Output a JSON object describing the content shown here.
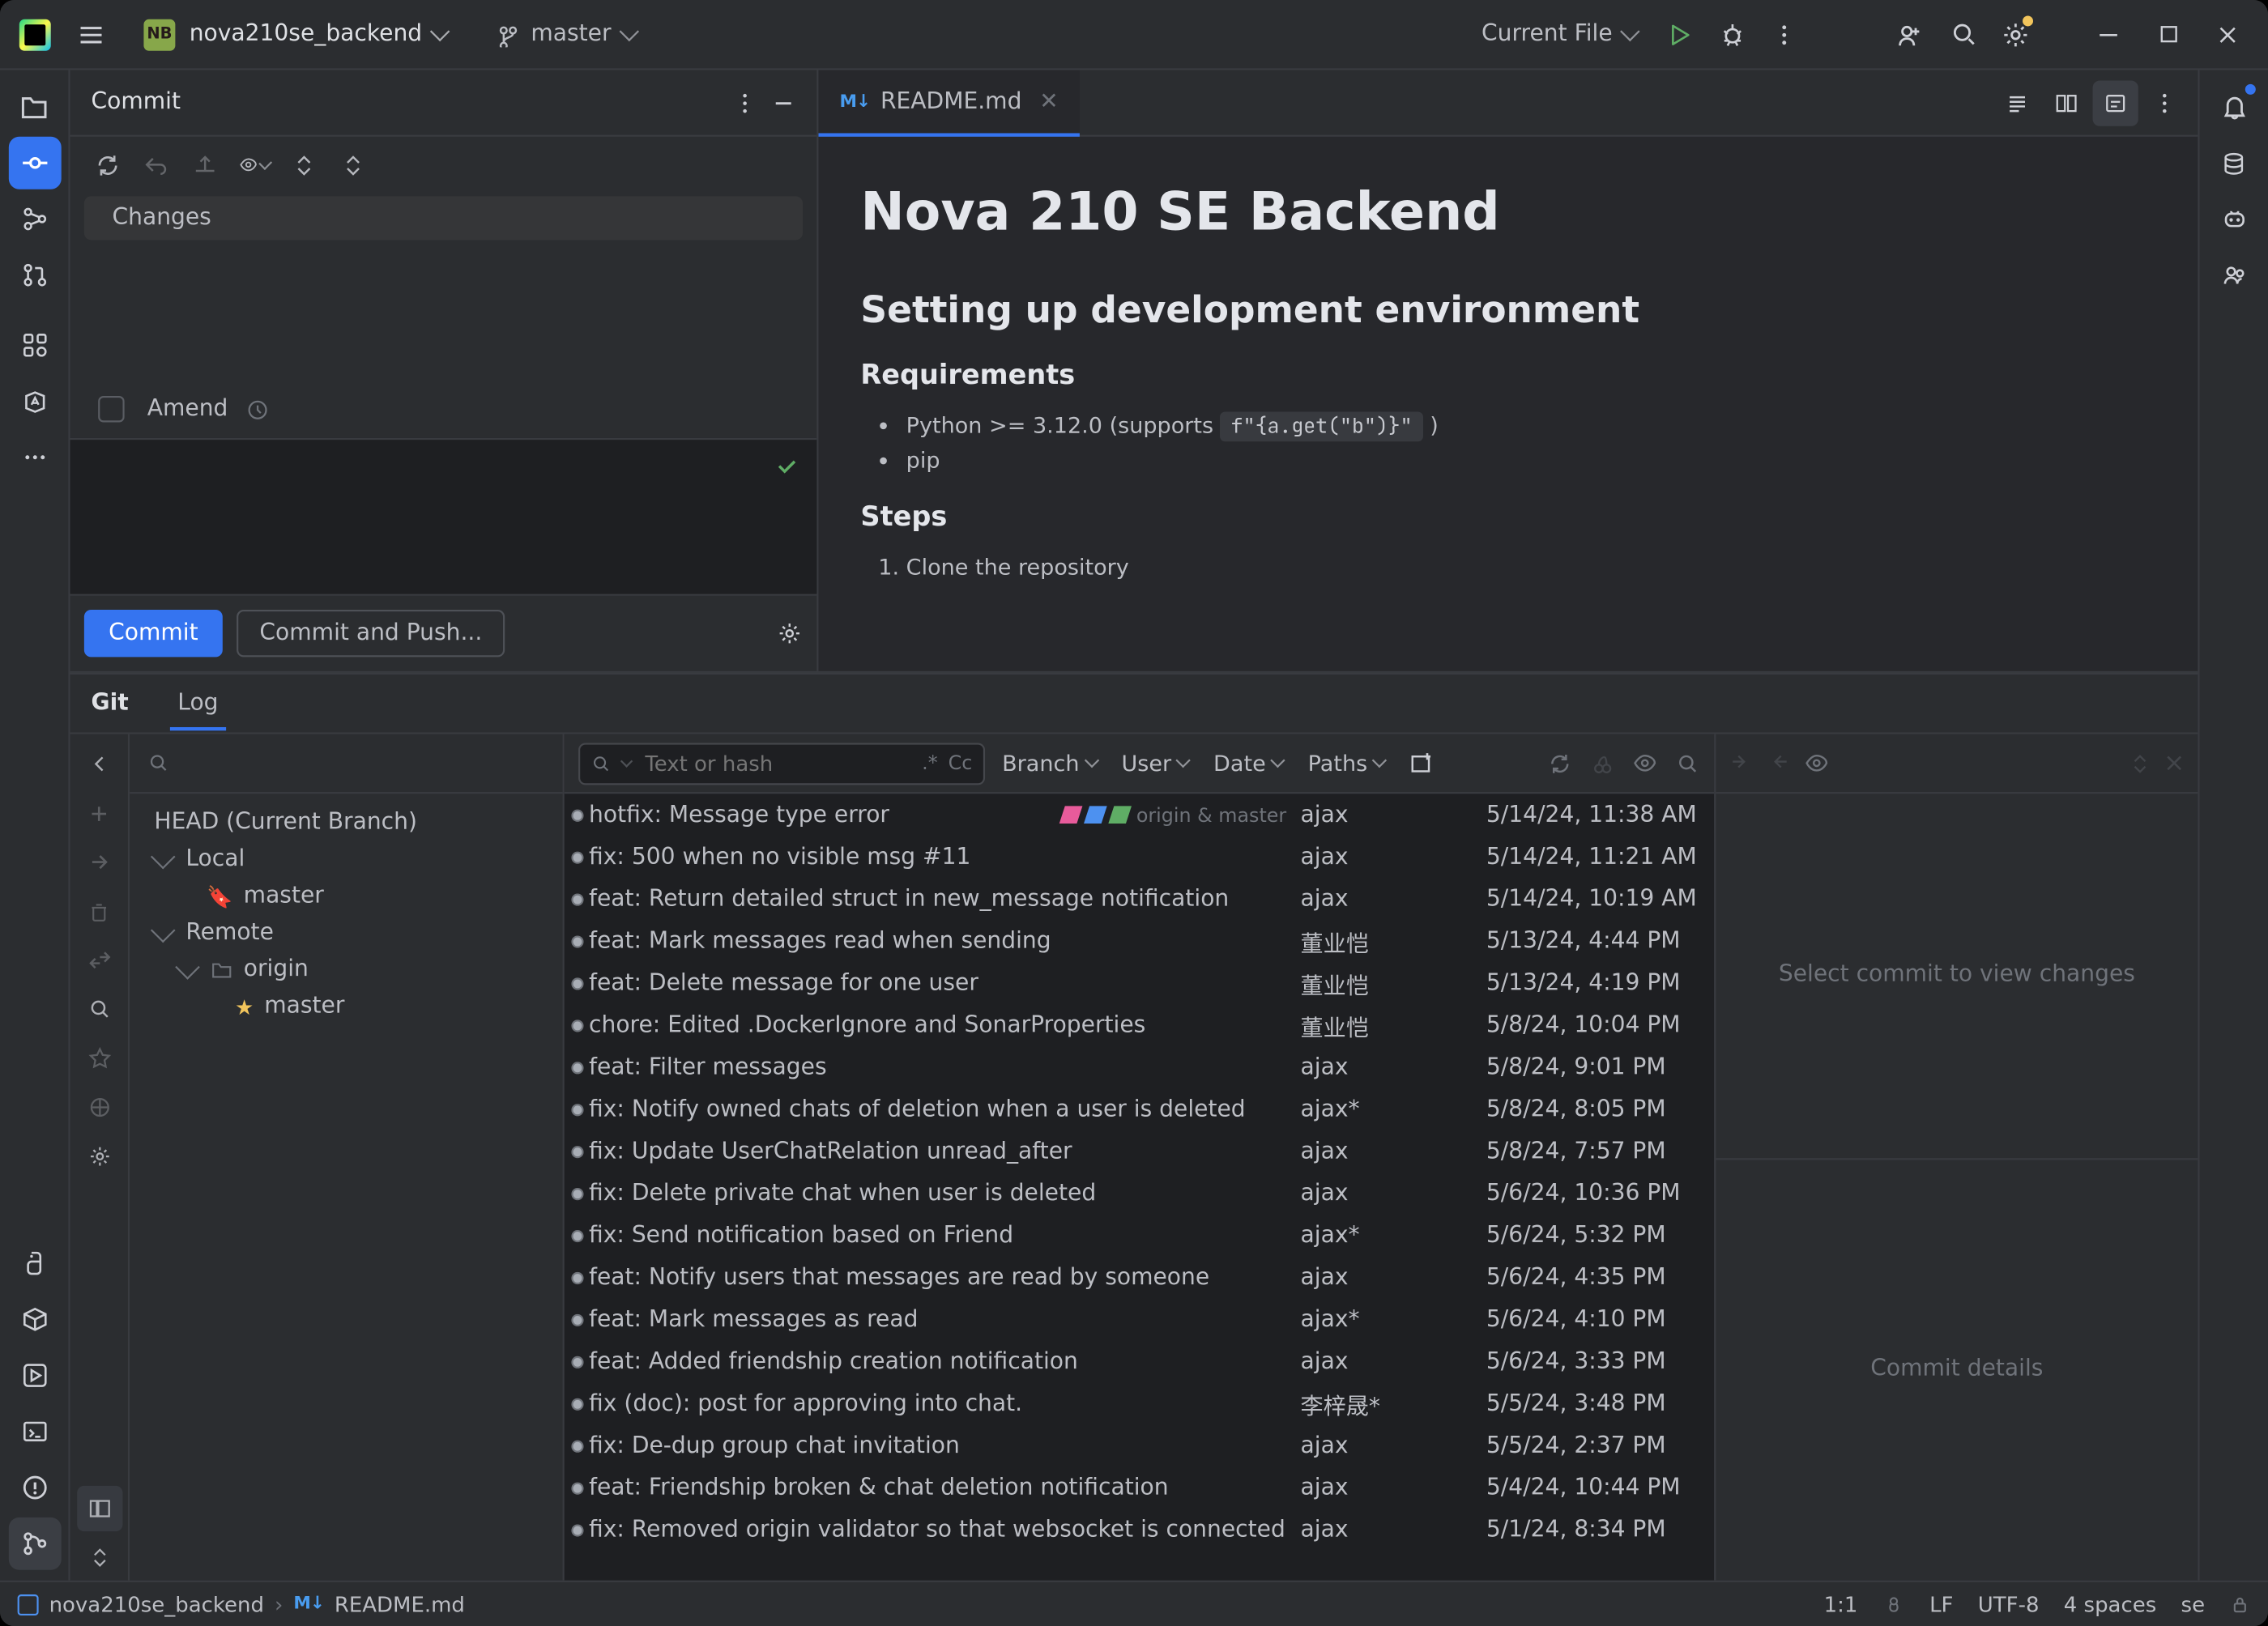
{
  "titlebar": {
    "project_badge": "NB",
    "project_name": "nova210se_backend",
    "branch": "master",
    "run_config": "Current File"
  },
  "commit": {
    "title": "Commit",
    "changes_label": "Changes",
    "amend_label": "Amend",
    "commit_btn": "Commit",
    "commit_push_btn": "Commit and Push..."
  },
  "editor": {
    "tab_file": "README.md",
    "h1": "Nova 210 SE Backend",
    "h2": "Setting up development environment",
    "h3_req": "Requirements",
    "req1_pre": "Python >= 3.12.0 (supports ",
    "req1_code": "f\"{a.get(\"b\")}\"",
    "req1_post": " )",
    "req2": "pip",
    "h3_steps": "Steps",
    "step1": "Clone the repository"
  },
  "git": {
    "tab_git": "Git",
    "tab_log": "Log",
    "search_placeholder": "Text or hash",
    "regex": ".*",
    "cc": "Cc",
    "f_branch": "Branch",
    "f_user": "User",
    "f_date": "Date",
    "f_paths": "Paths",
    "branches": {
      "head": "HEAD (Current Branch)",
      "local": "Local",
      "local_master": "master",
      "remote": "Remote",
      "origin": "origin",
      "origin_master": "master"
    },
    "details_placeholder": "Select commit to view changes",
    "details_bottom": "Commit details",
    "head_label": "origin & master",
    "commits": [
      {
        "msg": "hotfix: Message type error",
        "author": "ajax",
        "date": "5/14/24, 11:38 AM",
        "head": true
      },
      {
        "msg": "fix: 500 when no visible msg #11",
        "author": "ajax",
        "date": "5/14/24, 11:21 AM"
      },
      {
        "msg": "feat: Return detailed struct in new_message notification",
        "author": "ajax",
        "date": "5/14/24, 10:19 AM"
      },
      {
        "msg": "feat: Mark messages read when sending",
        "author": "董业恺",
        "date": "5/13/24, 4:44 PM"
      },
      {
        "msg": "feat: Delete message for one user",
        "author": "董业恺",
        "date": "5/13/24, 4:19 PM"
      },
      {
        "msg": "chore: Edited .DockerIgnore and SonarProperties",
        "author": "董业恺",
        "date": "5/8/24, 10:04 PM"
      },
      {
        "msg": "feat: Filter messages",
        "author": "ajax",
        "date": "5/8/24, 9:01 PM"
      },
      {
        "msg": "fix: Notify owned chats of deletion when a user is deleted",
        "author": "ajax*",
        "date": "5/8/24, 8:05 PM"
      },
      {
        "msg": "fix: Update UserChatRelation unread_after",
        "author": "ajax",
        "date": "5/8/24, 7:57 PM"
      },
      {
        "msg": "fix: Delete private chat when user is deleted",
        "author": "ajax",
        "date": "5/6/24, 10:36 PM"
      },
      {
        "msg": "fix: Send notification based on Friend",
        "author": "ajax*",
        "date": "5/6/24, 5:32 PM"
      },
      {
        "msg": "feat: Notify users that messages are read by someone",
        "author": "ajax",
        "date": "5/6/24, 4:35 PM"
      },
      {
        "msg": "feat: Mark messages as read",
        "author": "ajax*",
        "date": "5/6/24, 4:10 PM"
      },
      {
        "msg": "feat: Added friendship creation notification",
        "author": "ajax",
        "date": "5/6/24, 3:33 PM"
      },
      {
        "msg": "fix (doc): post for approving into chat.",
        "author": "李梓晟*",
        "date": "5/5/24, 3:48 PM"
      },
      {
        "msg": "fix: De-dup group chat invitation",
        "author": "ajax",
        "date": "5/5/24, 2:37 PM"
      },
      {
        "msg": "feat: Friendship broken & chat deletion notification",
        "author": "ajax",
        "date": "5/4/24, 10:44 PM"
      },
      {
        "msg": "fix: Removed origin validator so that websocket is connected",
        "author": "ajax",
        "date": "5/1/24, 8:34 PM"
      }
    ]
  },
  "statusbar": {
    "crumb1": "nova210se_backend",
    "crumb2": "README.md",
    "pos": "1:1",
    "eol": "LF",
    "enc": "UTF-8",
    "indent": "4 spaces",
    "lang": "se"
  }
}
